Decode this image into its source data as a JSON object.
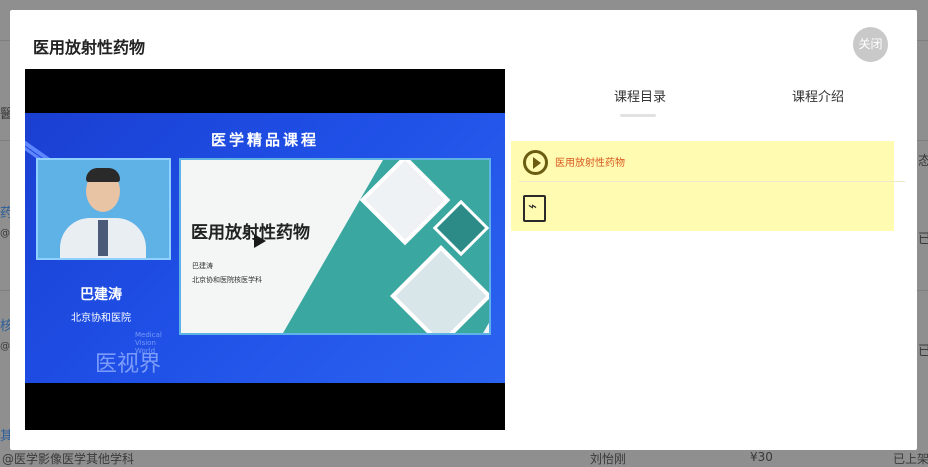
{
  "background_page": {
    "left_fragments": [
      "醫",
      "药",
      "@",
      "核",
      "@",
      "其"
    ],
    "right_fragments": [
      "态",
      "已上架",
      "已上架"
    ],
    "bottom_row": {
      "category": "@医学影像医学其他学科",
      "author": "刘怡刚",
      "price": "¥30",
      "status": "已上架"
    }
  },
  "modal": {
    "title": "医用放射性药物",
    "close_label": "关闭"
  },
  "video": {
    "banner": "医学精品课程",
    "presenter_name": "巴建涛",
    "presenter_hospital": "北京协和医院",
    "brand_cn": "医视界",
    "brand_en": "Medical Vision World",
    "slide_title": "医用放射性药物",
    "slide_author": "巴建涛",
    "slide_dept": "北京协和医院核医学科"
  },
  "tabs": [
    {
      "label": "课程目录",
      "active": true
    },
    {
      "label": "课程介绍",
      "active": false
    }
  ],
  "toc": {
    "items": [
      {
        "icon": "play-circle-icon",
        "label": "医用放射性药物"
      },
      {
        "icon": "pdf-icon",
        "label": ""
      }
    ],
    "highlight_color": "#fffbb0",
    "label_color": "#d9581f"
  }
}
